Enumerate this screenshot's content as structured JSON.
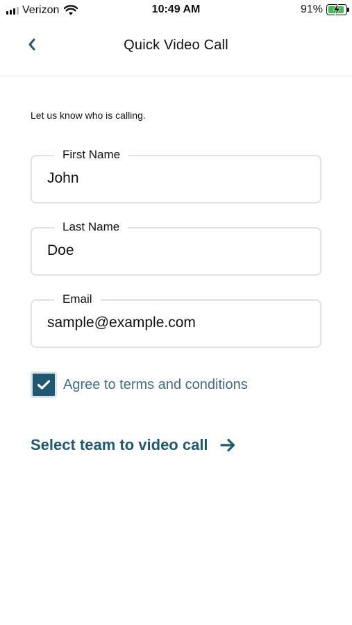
{
  "status_bar": {
    "carrier": "Verizon",
    "time": "10:49 AM",
    "battery_percent": "91%",
    "battery_level": 0.91,
    "battery_charging": true
  },
  "header": {
    "title": "Quick Video Call",
    "back_icon": "chevron-left-icon"
  },
  "form": {
    "intro": "Let us know who is calling.",
    "first_name": {
      "label": "First Name",
      "value": "John"
    },
    "last_name": {
      "label": "Last Name",
      "value": "Doe"
    },
    "email": {
      "label": "Email",
      "value": "sample@example.com"
    },
    "agree": {
      "label": "Agree to terms and conditions",
      "checked": true
    }
  },
  "cta": {
    "label": "Select team to video call",
    "icon": "arrow-right-icon"
  },
  "colors": {
    "accent": "#1f5873",
    "accent_light": "#3c6e88",
    "border": "#e2e2e2",
    "battery": "#37c24a"
  }
}
